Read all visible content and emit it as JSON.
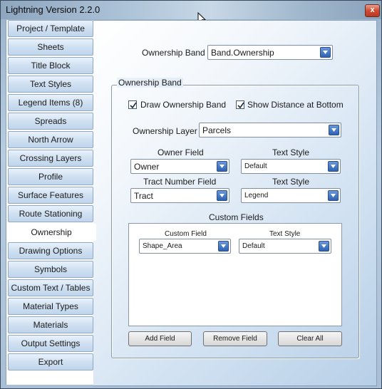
{
  "window": {
    "title": "Lightning Version 2.2.0",
    "close_glyph": "x"
  },
  "sidebar": {
    "items": [
      {
        "label": "Project / Template"
      },
      {
        "label": "Sheets"
      },
      {
        "label": "Title Block"
      },
      {
        "label": "Text Styles"
      },
      {
        "label": "Legend Items (8)"
      },
      {
        "label": "Spreads"
      },
      {
        "label": "North Arrow"
      },
      {
        "label": "Crossing Layers"
      },
      {
        "label": "Profile"
      },
      {
        "label": "Surface Features"
      },
      {
        "label": "Route Stationing"
      },
      {
        "label": "Ownership"
      },
      {
        "label": "Drawing Options"
      },
      {
        "label": "Symbols"
      },
      {
        "label": "Custom Text / Tables"
      },
      {
        "label": "Material Types"
      },
      {
        "label": "Materials"
      },
      {
        "label": "Output Settings"
      },
      {
        "label": "Export"
      }
    ],
    "active": "Ownership"
  },
  "main": {
    "ownership_band_label": "Ownership Band",
    "ownership_band_value": "Band.Ownership",
    "group_title": "Ownership Band",
    "draw_band_label": "Draw Ownership Band",
    "draw_band_checked": true,
    "show_distance_label": "Show Distance at Bottom",
    "show_distance_checked": true,
    "layer_label": "Ownership Layer",
    "layer_value": "Parcels",
    "owner_field_label": "Owner Field",
    "owner_field_value": "Owner",
    "owner_text_style_label": "Text Style",
    "owner_text_style_value": "Default",
    "tract_field_label": "Tract Number Field",
    "tract_field_value": "Tract",
    "tract_text_style_label": "Text Style",
    "tract_text_style_value": "Legend",
    "custom_fields_label": "Custom Fields",
    "custom_fields": {
      "field_header": "Custom Field",
      "style_header": "Text Style",
      "rows": [
        {
          "field": "Shape_Area",
          "style": "Default"
        }
      ]
    },
    "buttons": {
      "add": "Add Field",
      "remove": "Remove Field",
      "clear": "Clear All"
    }
  }
}
